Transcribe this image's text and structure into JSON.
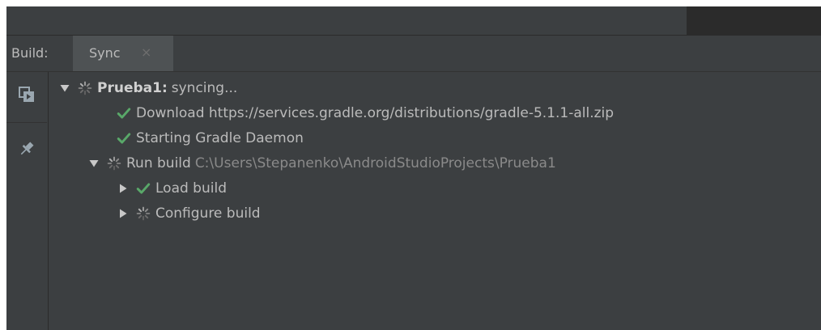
{
  "colors": {
    "panel_bg": "#3c3f41",
    "text": "#bbbbbb",
    "success_green": "#59a869",
    "spinner_gray": "#8c8c8c",
    "path_gray": "#8a8a8a"
  },
  "toolbar": {
    "build_label": "Build:",
    "tabs": [
      {
        "label": "Sync",
        "close_glyph": "×",
        "selected": true
      }
    ]
  },
  "sidebar": {
    "buttons": [
      {
        "icon": "restart-build-icon"
      },
      {
        "icon": "pin-icon"
      }
    ]
  },
  "tree": {
    "root": {
      "name": "Prueba1:",
      "status_text": "syncing...",
      "status": "in-progress",
      "expanded": true,
      "children": [
        {
          "label": "Download https://services.gradle.org/distributions/gradle-5.1.1-all.zip",
          "status": "success"
        },
        {
          "label": "Starting Gradle Daemon",
          "status": "success"
        },
        {
          "label": "Run build",
          "path": "C:\\Users\\Stepanenko\\AndroidStudioProjects\\Prueba1",
          "status": "in-progress",
          "expanded": true,
          "children": [
            {
              "label": "Load build",
              "status": "success",
              "expanded": false
            },
            {
              "label": "Configure build",
              "status": "in-progress",
              "expanded": false
            }
          ]
        }
      ]
    }
  }
}
